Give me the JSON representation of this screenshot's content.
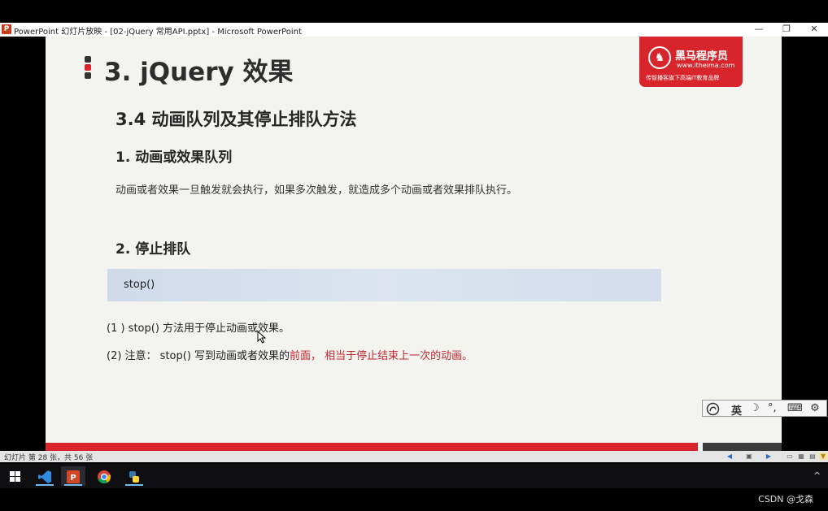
{
  "window": {
    "app_icon": "P",
    "title": "PowerPoint 幻灯片放映 - [02-jQuery 常用API.pptx] - Microsoft PowerPoint",
    "minimize": "—",
    "restore": "❐",
    "close": "✕"
  },
  "slide": {
    "title": "3. jQuery 效果",
    "logo": {
      "name": "黑马程序员",
      "url": "www.itheima.com",
      "slogan": "传智播客旗下高端IT教育品牌"
    },
    "subtitle": "3.4  动画队列及其停止排队方法",
    "section1_heading": "1. 动画或效果队列",
    "section1_text": "动画或者效果一旦触发就会执行，如果多次触发，就造成多个动画或者效果排队执行。",
    "section2_heading": "2. 停止排队",
    "code": "stop()",
    "note1": "(1 ) stop() 方法用于停止动画或效果。",
    "note2_prefix": "(2)  注意：  stop() 写到动画或者效果的",
    "note2_highlight": "前面，  相当于停止结束上一次的动画。"
  },
  "ime": {
    "mode": "英",
    "moon": "☽",
    "punct": "°,",
    "keyboard": "⌨",
    "settings": "⚙"
  },
  "status": {
    "text": "幻灯片 第 28 张，共 56 张"
  },
  "taskbar": {
    "items": [
      "windows-start",
      "vscode",
      "powerpoint",
      "chrome",
      "python"
    ]
  },
  "watermark": "CSDN @戈森",
  "colors": {
    "accent_red": "#d8242b",
    "highlight_red": "#c0262d",
    "code_bg": "#d5dfed"
  }
}
